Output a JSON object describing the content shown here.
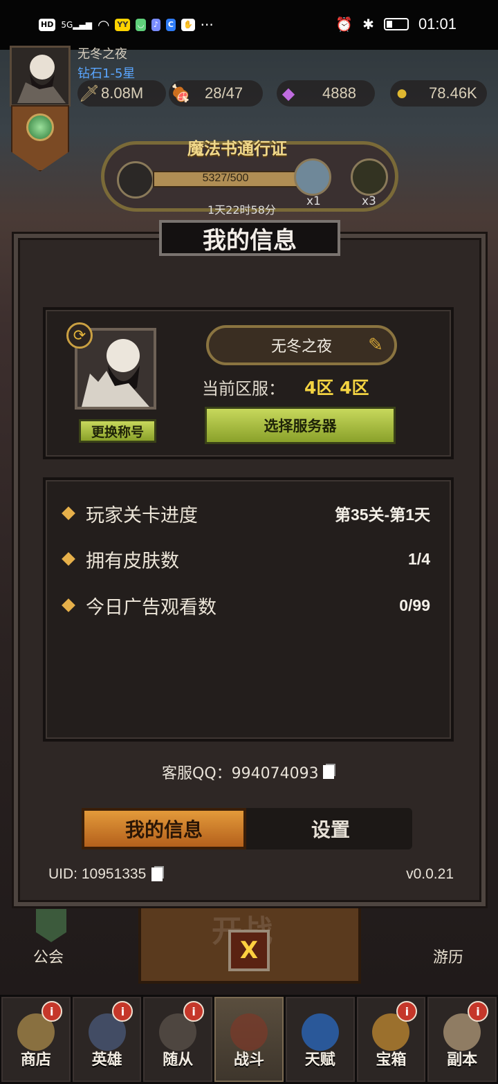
{
  "status_bar": {
    "left_icons": [
      "HD",
      "5G",
      "signal",
      "wifi",
      "app-yy",
      "app-cat",
      "app-music",
      "app-c",
      "app-hand",
      "more"
    ],
    "time": "01:01"
  },
  "player": {
    "name": "无冬之夜",
    "rank": "钻石1-5星",
    "power": "8.08M",
    "stamina": "28/47",
    "gems": "4888",
    "gold": "78.46K"
  },
  "pass": {
    "title": "魔法书通行证",
    "progress": "5327/500",
    "reward1_count": "x1",
    "reward2_count": "x3",
    "timer": "1天22时58分"
  },
  "modal": {
    "title": "我的信息",
    "profile": {
      "name": "无冬之夜",
      "server_label": "当前区服：",
      "server_value": "4区 4区",
      "rename_button": "更换称号",
      "select_server_button": "选择服务器"
    },
    "stats": [
      {
        "label": "玩家关卡进度",
        "value": "第35关-第1天"
      },
      {
        "label": "拥有皮肤数",
        "value": "1/4"
      },
      {
        "label": "今日广告观看数",
        "value": "0/99"
      }
    ],
    "support_qq": "客服QQ：994074093",
    "tabs": {
      "info": "我的信息",
      "settings": "设置"
    },
    "uid": "UID: 10951335",
    "version": "v0.0.21"
  },
  "lower": {
    "guild": "公会",
    "travel": "游历",
    "close_symbol": "X",
    "fight_ghost": "开战"
  },
  "nav": [
    {
      "label": "商店",
      "badge": "i",
      "icon": "bag-icon"
    },
    {
      "label": "英雄",
      "badge": "i",
      "icon": "helmet-icon"
    },
    {
      "label": "随从",
      "badge": "i",
      "icon": "minion-icon"
    },
    {
      "label": "战斗",
      "badge": "",
      "icon": "crossed-swords-icon"
    },
    {
      "label": "天赋",
      "badge": "",
      "icon": "shield-arrow-icon"
    },
    {
      "label": "宝箱",
      "badge": "i",
      "icon": "chest-icon"
    },
    {
      "label": "副本",
      "badge": "i",
      "icon": "scroll-icon"
    }
  ],
  "colors": {
    "accent_gold": "#f4d442",
    "green_button": "#8aa12a",
    "tab_orange": "#e39a3a",
    "rank_blue": "#5aa6ff",
    "badge_red": "#c5372a"
  }
}
